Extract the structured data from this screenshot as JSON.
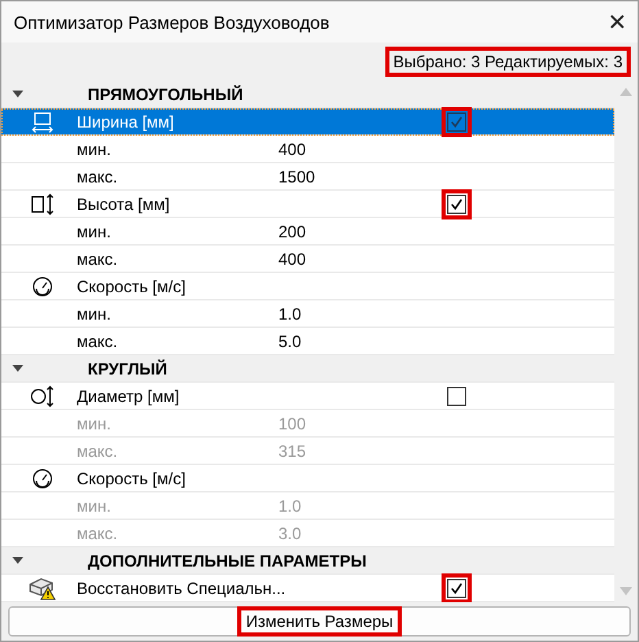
{
  "window": {
    "title": "Оптимизатор Размеров Воздуховодов",
    "close": "✕"
  },
  "status": {
    "text": "Выбрано: 3 Редактируемых: 3",
    "highlighted": true
  },
  "sections": [
    {
      "title": "ПРЯМОУГОЛЬНЫЙ",
      "expanded": true,
      "items": [
        {
          "kind": "toggle",
          "label": "Ширина [мм]",
          "checked": true,
          "selected": true,
          "highlighted": true
        },
        {
          "kind": "value",
          "label": "мин.",
          "value": "400",
          "disabled": false,
          "selected": false
        },
        {
          "kind": "value",
          "label": "макс.",
          "value": "1500",
          "disabled": false,
          "selected": false
        },
        {
          "kind": "toggle",
          "label": "Высота [мм]",
          "checked": true,
          "selected": false,
          "highlighted": true
        },
        {
          "kind": "value",
          "label": "мин.",
          "value": "200",
          "disabled": false,
          "selected": false
        },
        {
          "kind": "value",
          "label": "макс.",
          "value": "400",
          "disabled": false,
          "selected": false
        },
        {
          "kind": "param",
          "label": "Скорость [м/с]",
          "selected": false
        },
        {
          "kind": "value",
          "label": "мин.",
          "value": "1.0",
          "disabled": false,
          "selected": false
        },
        {
          "kind": "value",
          "label": "макс.",
          "value": "5.0",
          "disabled": false,
          "selected": false
        }
      ]
    },
    {
      "title": "КРУГЛЫЙ",
      "expanded": true,
      "items": [
        {
          "kind": "toggle",
          "label": "Диаметр [мм]",
          "checked": false,
          "selected": false,
          "highlighted": false
        },
        {
          "kind": "value",
          "label": "мин.",
          "value": "100",
          "disabled": true,
          "selected": false
        },
        {
          "kind": "value",
          "label": "макс.",
          "value": "315",
          "disabled": true,
          "selected": false
        },
        {
          "kind": "param",
          "label": "Скорость [м/с]",
          "selected": false
        },
        {
          "kind": "value",
          "label": "мин.",
          "value": "1.0",
          "disabled": true,
          "selected": false
        },
        {
          "kind": "value",
          "label": "макс.",
          "value": "3.0",
          "disabled": true,
          "selected": false
        }
      ]
    },
    {
      "title": "ДОПОЛНИТЕЛЬНЫЕ ПАРАМЕТРЫ",
      "expanded": true,
      "items": [
        {
          "kind": "toggle",
          "label": "Восстановить Специальн...",
          "checked": true,
          "selected": false,
          "highlighted": true
        }
      ]
    }
  ],
  "button": {
    "label": "Изменить Размеры",
    "highlighted": true
  }
}
